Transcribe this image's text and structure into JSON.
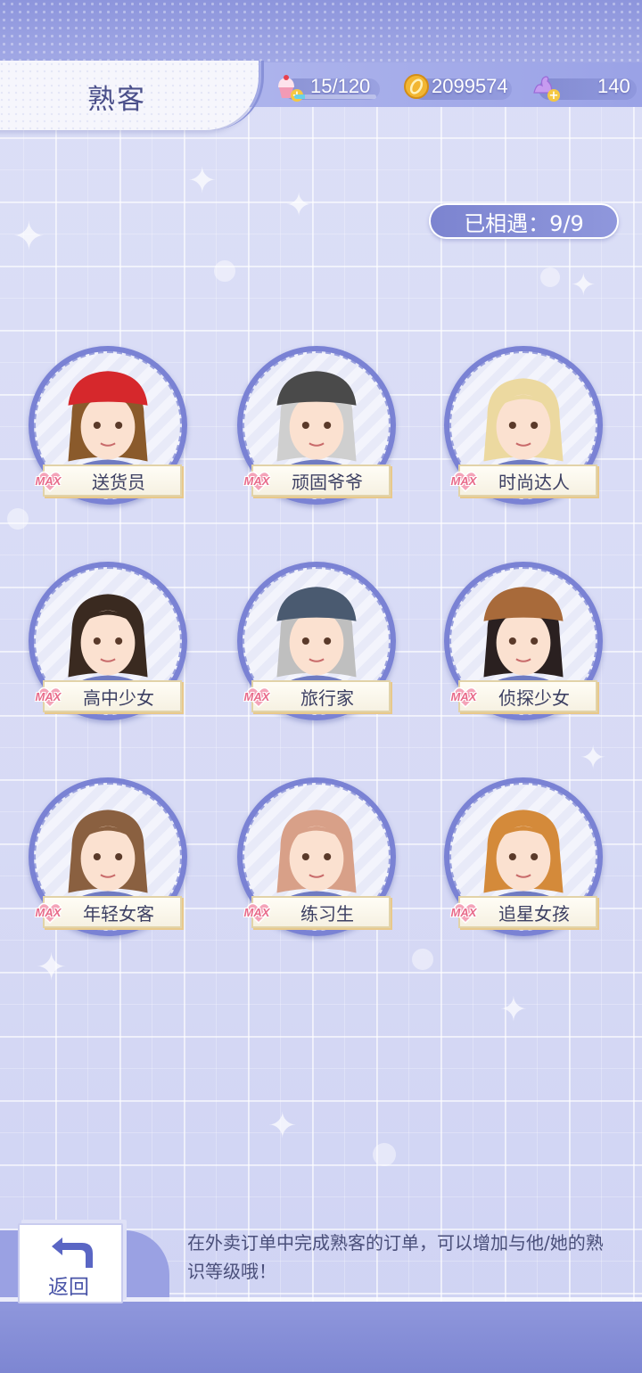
{
  "header": {
    "title": "熟客",
    "stamina": {
      "label": "15/120",
      "fill": 0.125,
      "icon": "cupcake-icon"
    },
    "coins": {
      "label": "2099574",
      "icon": "gold-coin-icon"
    },
    "gems": {
      "label": "140",
      "icon": "purple-swan-icon"
    }
  },
  "met_badge": {
    "label": "已相遇：9/9"
  },
  "max_label": "MAX",
  "customers": [
    {
      "name": "送货员",
      "level": "MAX"
    },
    {
      "name": "顽固爷爷",
      "level": "MAX"
    },
    {
      "name": "时尚达人",
      "level": "MAX"
    },
    {
      "name": "高中少女",
      "level": "MAX"
    },
    {
      "name": "旅行家",
      "level": "MAX"
    },
    {
      "name": "侦探少女",
      "level": "MAX"
    },
    {
      "name": "年轻女客",
      "level": "MAX"
    },
    {
      "name": "练习生",
      "level": "MAX"
    },
    {
      "name": "追星女孩",
      "level": "MAX"
    }
  ],
  "footer": {
    "back_label": "返回",
    "hint": "在外卖订单中完成熟客的订单，可以增加与他/她的熟识等级哦！"
  },
  "colors": {
    "accent": "#7a82d4",
    "plate_border": "#e2d3a8",
    "max_pink": "#e86a8a"
  }
}
